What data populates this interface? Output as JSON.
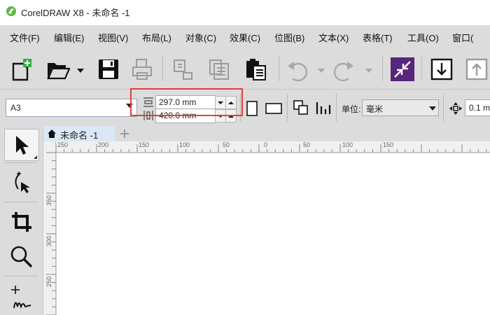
{
  "window": {
    "title": "CorelDRAW X8 - 未命名 -1"
  },
  "menu": {
    "items": [
      "文件(F)",
      "编辑(E)",
      "视图(V)",
      "布局(L)",
      "对象(C)",
      "效果(C)",
      "位图(B)",
      "文本(X)",
      "表格(T)",
      "工具(O)",
      "窗口("
    ]
  },
  "property_bar": {
    "paper_size": "A3",
    "width_value": "297.0 mm",
    "height_value": "420.0 mm",
    "units_label": "单位:",
    "units_value": "毫米",
    "nudge_value": "0.1 m"
  },
  "document": {
    "tab_label": "未命名 -1"
  },
  "rulers": {
    "horizontal": [
      "250",
      "200",
      "150",
      "100",
      "50",
      "0",
      "50",
      "100",
      "150"
    ],
    "vertical": [
      "350",
      "300",
      "250",
      "200"
    ]
  },
  "colors": {
    "accent_green": "#2cae3f",
    "highlight_red": "#e0403c",
    "tab_blue": "#dbe7f6"
  }
}
